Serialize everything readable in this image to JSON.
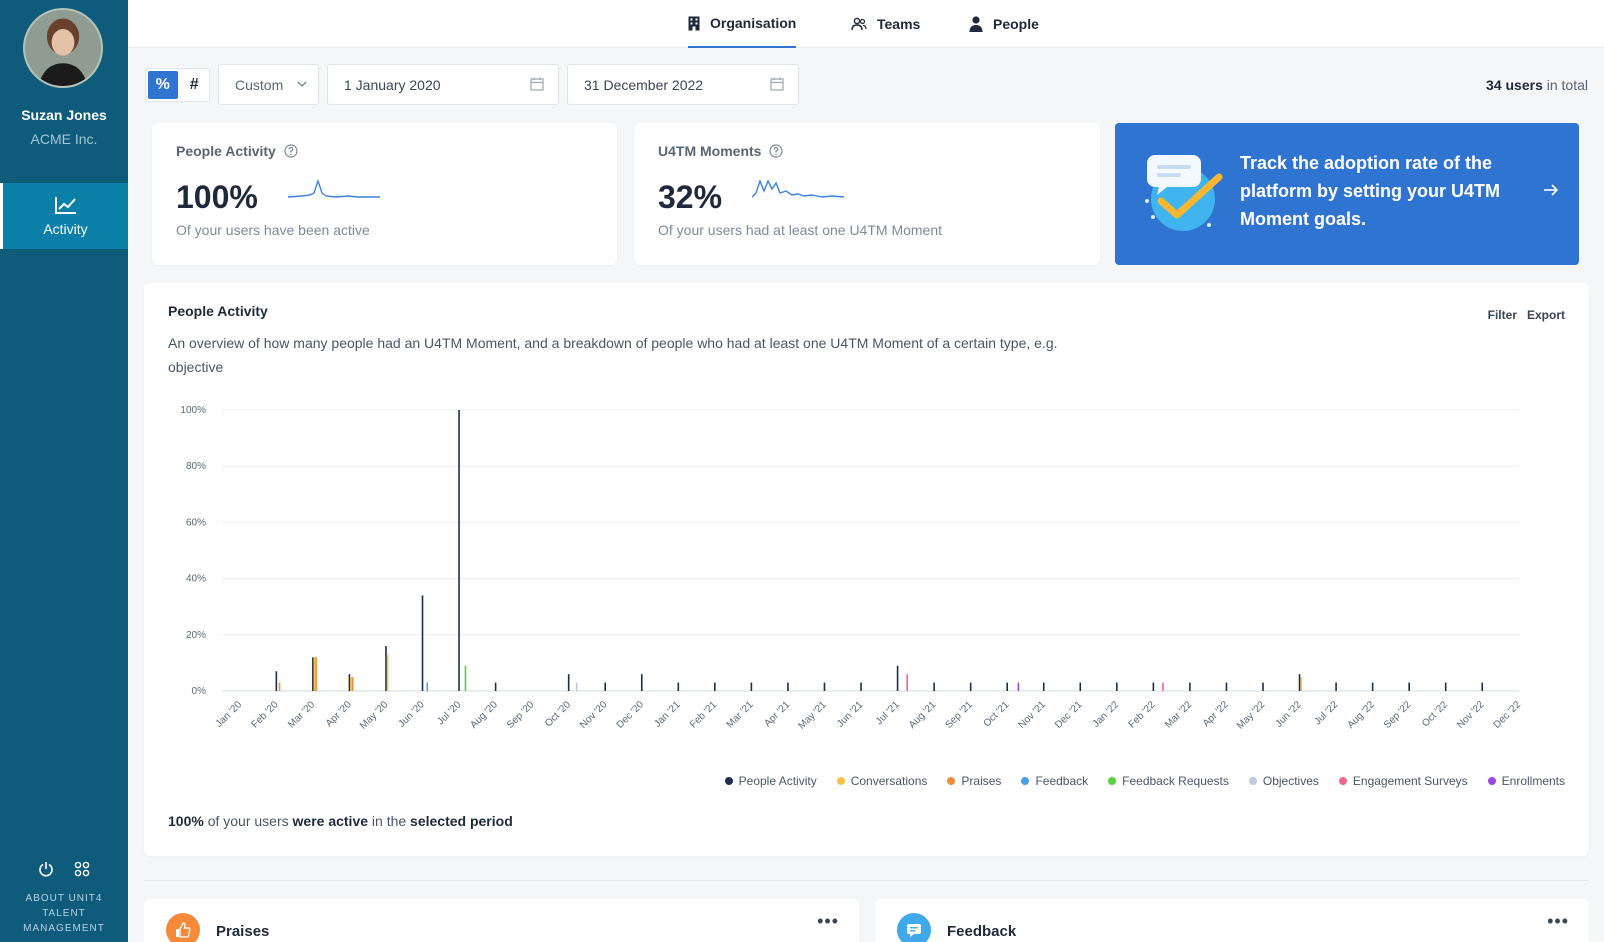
{
  "sidebar": {
    "user_name": "Suzan Jones",
    "company": "ACME Inc.",
    "nav_activity": "Activity",
    "about": [
      "ABOUT UNIT4",
      "TALENT",
      "MANAGEMENT"
    ]
  },
  "topnav": {
    "tabs": [
      "Organisation",
      "Teams",
      "People"
    ],
    "active": "Organisation"
  },
  "toolbar": {
    "percent_symbol": "%",
    "count_symbol": "#",
    "range_select": "Custom",
    "start_date": "1 January 2020",
    "end_date": "31 December 2022",
    "users_count": "34 users",
    "users_suffix": " in total"
  },
  "cards": {
    "people_activity": {
      "title": "People Activity",
      "value": "100%",
      "desc": "Of your users have been active"
    },
    "moments": {
      "title": "U4TM Moments",
      "value": "32%",
      "desc": "Of your users had at least one U4TM Moment"
    },
    "promo": {
      "text": "Track the adoption rate of the platform by setting your U4TM Moment goals."
    }
  },
  "chart_card": {
    "title": "People Activity",
    "desc": "An overview of how many people had an U4TM Moment, and a breakdown of people who had at least one U4TM Moment of a certain type, e.g. objective",
    "filter": "Filter",
    "export": "Export",
    "summary_value": "100%",
    "summary_mid1": " of your users ",
    "summary_bold1": "were active",
    "summary_mid2": " in the ",
    "summary_bold2": "selected period"
  },
  "chart_data": {
    "type": "bar",
    "ylim": [
      0,
      100
    ],
    "yticks": [
      "0%",
      "20%",
      "40%",
      "60%",
      "80%",
      "100%"
    ],
    "categories": [
      "Jan '20",
      "Feb '20",
      "Mar '20",
      "Apr '20",
      "May '20",
      "Jun '20",
      "Jul '20",
      "Aug '20",
      "Sep '20",
      "Oct '20",
      "Nov '20",
      "Dec '20",
      "Jan '21",
      "Feb '21",
      "Mar '21",
      "Apr '21",
      "May '21",
      "Jun '21",
      "Jul '21",
      "Aug '21",
      "Sep '21",
      "Oct '21",
      "Nov '21",
      "Dec '21",
      "Jan '22",
      "Feb '22",
      "Mar '22",
      "Apr '22",
      "May '22",
      "Jun '22",
      "Jul '22",
      "Aug '22",
      "Sep '22",
      "Oct '22",
      "Nov '22",
      "Dec '22"
    ],
    "series": [
      {
        "name": "People Activity",
        "color": "#1f2d4d",
        "values": [
          0,
          7,
          12,
          6,
          16,
          34,
          100,
          3,
          0,
          6,
          3,
          6,
          3,
          3,
          3,
          3,
          3,
          3,
          9,
          3,
          3,
          3,
          3,
          3,
          3,
          3,
          3,
          3,
          3,
          6,
          3,
          3,
          3,
          3,
          3,
          0
        ]
      },
      {
        "name": "Conversations",
        "color": "#f5c242",
        "values": [
          0,
          0,
          12,
          5,
          13,
          0,
          0,
          0,
          0,
          0,
          0,
          0,
          0,
          0,
          0,
          0,
          0,
          0,
          0,
          0,
          0,
          0,
          0,
          0,
          0,
          0,
          0,
          0,
          0,
          5,
          0,
          0,
          0,
          0,
          0,
          0
        ]
      },
      {
        "name": "Praises",
        "color": "#f28c38",
        "values": [
          0,
          3,
          12,
          5,
          0,
          0,
          0,
          0,
          0,
          0,
          0,
          0,
          0,
          0,
          0,
          0,
          0,
          0,
          0,
          0,
          0,
          0,
          0,
          0,
          0,
          0,
          0,
          0,
          0,
          0,
          0,
          0,
          0,
          0,
          0,
          0
        ]
      },
      {
        "name": "Feedback",
        "color": "#4a9fe3",
        "values": [
          0,
          0,
          0,
          0,
          0,
          3,
          0,
          0,
          0,
          0,
          0,
          0,
          0,
          0,
          0,
          0,
          0,
          0,
          0,
          0,
          0,
          0,
          0,
          0,
          0,
          0,
          0,
          0,
          0,
          0,
          0,
          0,
          0,
          0,
          0,
          0
        ]
      },
      {
        "name": "Feedback Requests",
        "color": "#57d13c",
        "values": [
          0,
          0,
          0,
          0,
          0,
          0,
          9,
          0,
          0,
          0,
          0,
          0,
          0,
          0,
          0,
          0,
          0,
          0,
          0,
          0,
          0,
          0,
          0,
          0,
          0,
          0,
          0,
          0,
          0,
          0,
          0,
          0,
          0,
          0,
          0,
          0
        ]
      },
      {
        "name": "Objectives",
        "color": "#c3c8de",
        "values": [
          0,
          0,
          0,
          0,
          0,
          0,
          0,
          0,
          0,
          3,
          0,
          0,
          0,
          0,
          0,
          0,
          0,
          0,
          0,
          0,
          0,
          0,
          0,
          0,
          0,
          0,
          0,
          0,
          0,
          0,
          0,
          0,
          0,
          0,
          0,
          0
        ]
      },
      {
        "name": "Engagement Surveys",
        "color": "#f0668a",
        "values": [
          0,
          0,
          0,
          0,
          0,
          0,
          0,
          0,
          0,
          0,
          0,
          0,
          0,
          0,
          0,
          0,
          0,
          0,
          6,
          0,
          0,
          0,
          0,
          0,
          0,
          3,
          0,
          0,
          0,
          0,
          0,
          0,
          0,
          0,
          0,
          0
        ]
      },
      {
        "name": "Enrollments",
        "color": "#9b46e0",
        "values": [
          0,
          0,
          0,
          0,
          0,
          0,
          0,
          0,
          0,
          0,
          0,
          0,
          0,
          0,
          0,
          0,
          0,
          0,
          0,
          0,
          0,
          3,
          0,
          0,
          0,
          0,
          0,
          0,
          0,
          0,
          0,
          0,
          0,
          0,
          0,
          0
        ]
      }
    ]
  },
  "bottom": {
    "praises": "Praises",
    "feedback": "Feedback",
    "more": "•••"
  },
  "colors": {
    "sidebar": "#0f5b7c",
    "accent": "#2f74d0"
  }
}
